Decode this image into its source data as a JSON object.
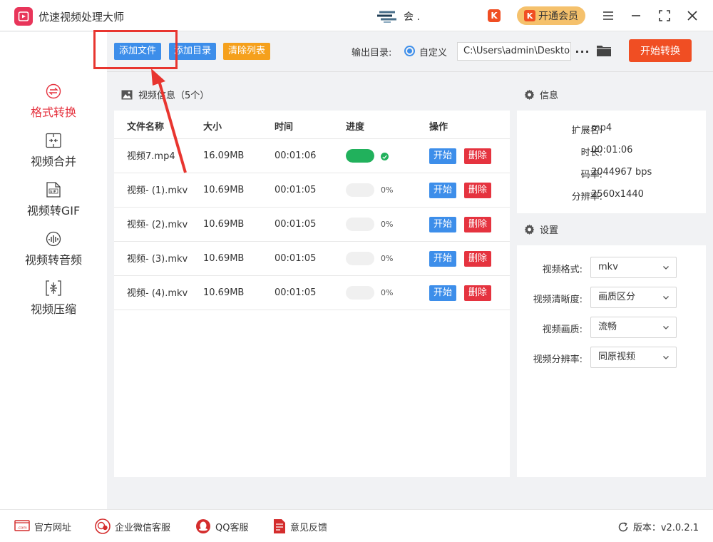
{
  "app": {
    "title": "优速视频处理大师"
  },
  "titlebar": {
    "user_name": "会  .",
    "vip_badge": "K",
    "vip_label": "开通会员"
  },
  "toolbar": {
    "add_file": "添加文件",
    "add_dir": "添加目录",
    "clear_list": "清除列表",
    "output_label": "输出目录:",
    "custom_label": "自定义",
    "output_path": "C:\\Users\\admin\\Deskto",
    "more": "···",
    "start_convert": "开始转换"
  },
  "sidebar": {
    "items": [
      {
        "label": "格式转换",
        "active": true
      },
      {
        "label": "视频合并"
      },
      {
        "label": "视频转GIF"
      },
      {
        "label": "视频转音频"
      },
      {
        "label": "视频压缩"
      }
    ]
  },
  "filelist": {
    "title": "视频信息（5个）",
    "columns": {
      "name": "文件名称",
      "size": "大小",
      "time": "时间",
      "progress": "进度",
      "action": "操作"
    },
    "rows": [
      {
        "name": "视频7.mp4",
        "size": "16.09MB",
        "time": "00:01:06",
        "progress": 1.0,
        "pct": "",
        "start": "开始",
        "delete": "删除"
      },
      {
        "name": "视频- (1).mkv",
        "size": "10.69MB",
        "time": "00:01:05",
        "progress": 0,
        "pct": "0%",
        "start": "开始",
        "delete": "删除"
      },
      {
        "name": "视频- (2).mkv",
        "size": "10.69MB",
        "time": "00:01:05",
        "progress": 0,
        "pct": "0%",
        "start": "开始",
        "delete": "删除"
      },
      {
        "name": "视频- (3).mkv",
        "size": "10.69MB",
        "time": "00:01:05",
        "progress": 0,
        "pct": "0%",
        "start": "开始",
        "delete": "删除"
      },
      {
        "name": "视频- (4).mkv",
        "size": "10.69MB",
        "time": "00:01:05",
        "progress": 0,
        "pct": "0%",
        "start": "开始",
        "delete": "删除"
      }
    ]
  },
  "info": {
    "title": "信息",
    "ext_label": "扩展名:",
    "ext": "mp4",
    "duration_label": "时长:",
    "duration": "00:01:06",
    "bitrate_label": "码率:",
    "bitrate": "2044967 bps",
    "resolution_label": "分辨率:",
    "resolution": "2560x1440"
  },
  "settings": {
    "title": "设置",
    "format_label": "视频格式:",
    "format": "mkv",
    "clarity_label": "视频清晰度:",
    "clarity": "画质区分",
    "quality_label": "视频画质:",
    "quality": "流畅",
    "res_label": "视频分辨率:",
    "res": "同原视频"
  },
  "footer": {
    "website": "官方网址",
    "wechat": "企业微信客服",
    "qq": "QQ客服",
    "feedback": "意见反馈",
    "version": "版本：v2.0.2.1"
  },
  "colors": {
    "accent_blue": "#3d8eea",
    "accent_red": "#f04e23",
    "orange": "#f5a01c",
    "success": "#21b15c",
    "active_nav": "#e5333f"
  }
}
